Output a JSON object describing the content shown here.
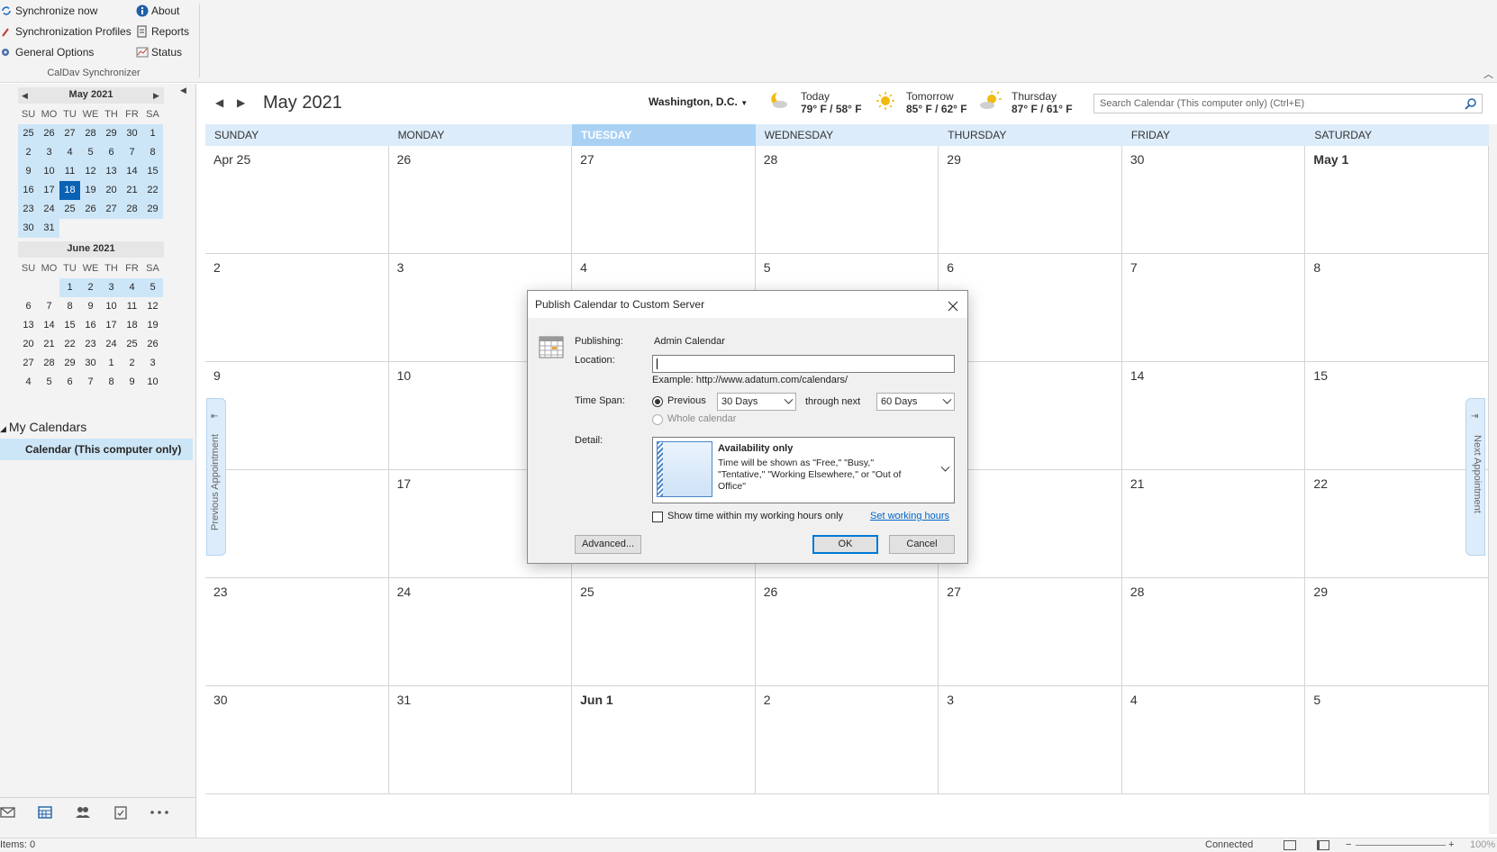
{
  "ribbon": {
    "sync_now": "Synchronize now",
    "sync_profiles": "Synchronization Profiles",
    "general_options": "General Options",
    "about": "About",
    "reports": "Reports",
    "status": "Status",
    "group_label": "CalDav Synchronizer"
  },
  "minical": {
    "month1_title": "May 2021",
    "month2_title": "June 2021",
    "dow": [
      "SU",
      "MO",
      "TU",
      "WE",
      "TH",
      "FR",
      "SA"
    ],
    "may_days": [
      "25",
      "26",
      "27",
      "28",
      "29",
      "30",
      "1",
      "2",
      "3",
      "4",
      "5",
      "6",
      "7",
      "8",
      "9",
      "10",
      "11",
      "12",
      "13",
      "14",
      "15",
      "16",
      "17",
      "18",
      "19",
      "20",
      "21",
      "22",
      "23",
      "24",
      "25",
      "26",
      "27",
      "28",
      "29",
      "30",
      "31"
    ],
    "june_days": [
      "",
      "",
      "1",
      "2",
      "3",
      "4",
      "5",
      "6",
      "7",
      "8",
      "9",
      "10",
      "11",
      "12",
      "13",
      "14",
      "15",
      "16",
      "17",
      "18",
      "19",
      "20",
      "21",
      "22",
      "23",
      "24",
      "25",
      "26",
      "27",
      "28",
      "29",
      "30",
      "1",
      "2",
      "3",
      "4",
      "5",
      "6",
      "7",
      "8",
      "9",
      "10"
    ],
    "selected_day": "18"
  },
  "my_calendars": {
    "heading": "My Calendars",
    "item": "Calendar (This computer only)"
  },
  "header": {
    "title": "May 2021",
    "location": "Washington, D.C.",
    "weather": [
      {
        "day": "Today",
        "temp": "79° F / 58° F",
        "icon": "moon-cloud-icon"
      },
      {
        "day": "Tomorrow",
        "temp": "85° F / 62° F",
        "icon": "sun-icon"
      },
      {
        "day": "Thursday",
        "temp": "87° F / 61° F",
        "icon": "sun-cloud-icon"
      }
    ],
    "search_placeholder": "Search Calendar (This computer only) (Ctrl+E)"
  },
  "calendar": {
    "weekdays": [
      "SUNDAY",
      "MONDAY",
      "TUESDAY",
      "WEDNESDAY",
      "THURSDAY",
      "FRIDAY",
      "SATURDAY"
    ],
    "today_weekday": "TUESDAY",
    "weeks": [
      [
        "Apr 25",
        "26",
        "27",
        "28",
        "29",
        "30",
        "May 1"
      ],
      [
        "2",
        "3",
        "4",
        "5",
        "6",
        "7",
        "8"
      ],
      [
        "9",
        "10",
        "",
        "",
        "",
        "14",
        "15"
      ],
      [
        "",
        "17",
        "",
        "",
        "",
        "21",
        "22"
      ],
      [
        "23",
        "24",
        "25",
        "26",
        "27",
        "28",
        "29"
      ],
      [
        "30",
        "31",
        "Jun 1",
        "2",
        "3",
        "4",
        "5"
      ]
    ],
    "prev_appointment": "Previous Appointment",
    "next_appointment": "Next Appointment"
  },
  "dialog": {
    "title": "Publish Calendar to Custom Server",
    "publishing_label": "Publishing:",
    "publishing_value": "Admin Calendar",
    "location_label": "Location:",
    "location_value": "",
    "example": "Example: http://www.adatum.com/calendars/",
    "timespan_label": "Time Span:",
    "previous_label": "Previous",
    "previous_value": "30 Days",
    "through_label": "through next",
    "next_value": "60 Days",
    "whole_label": "Whole calendar",
    "detail_label": "Detail:",
    "detail_title": "Availability only",
    "detail_desc": "Time will be shown as \"Free,\" \"Busy,\" \"Tentative,\" \"Working Elsewhere,\" or \"Out of Office\"",
    "working_hours_label": "Show time within my working hours only",
    "set_working_hours": "Set working hours",
    "advanced": "Advanced...",
    "ok": "OK",
    "cancel": "Cancel"
  },
  "statusbar": {
    "items": "Items: 0",
    "connected": "Connected",
    "zoom": "100%"
  }
}
